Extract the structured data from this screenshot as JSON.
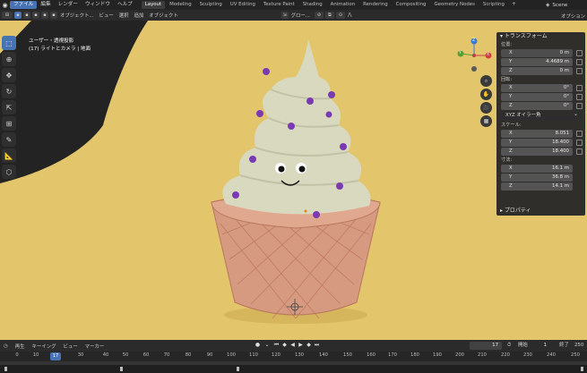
{
  "topbar": {
    "menus": [
      "ファイル",
      "編集",
      "レンダー",
      "ウィンドウ",
      "ヘルプ"
    ],
    "workspaces": [
      "Layout",
      "Modeling",
      "Sculpting",
      "UV Editing",
      "Texture Paint",
      "Shading",
      "Animation",
      "Rendering",
      "Compositing",
      "Geometry Nodes",
      "Scripting"
    ],
    "plus": "+",
    "scene": "Scene"
  },
  "vp_header": {
    "mode": "オブジェクト...",
    "view": "ビュー",
    "select": "選択",
    "add": "追加",
    "object": "オブジェクト",
    "transform_orientation": "グロー...",
    "options": "オプション"
  },
  "viewport": {
    "view_name": "ユーザー・透視投影",
    "collection": "(17) ライトとカメラ | 地面",
    "colors": {
      "background": "#e3c56b",
      "floor": "#222222",
      "cream": "#d9d9c0",
      "cone": "#d7977c",
      "sprinkle": "#7a3bb2"
    }
  },
  "npanel": {
    "transform_title": "トランスフォーム",
    "location_label": "位置:",
    "location": [
      {
        "axis": "X",
        "value": "0 m"
      },
      {
        "axis": "Y",
        "value": "4.4689 m"
      },
      {
        "axis": "Z",
        "value": "0 m"
      }
    ],
    "rotation_label": "回転:",
    "rotation": [
      {
        "axis": "X",
        "value": "0°"
      },
      {
        "axis": "Y",
        "value": "0°"
      },
      {
        "axis": "Z",
        "value": "0°"
      }
    ],
    "rotation_mode": "XYZ オイラー角",
    "scale_label": "スケール:",
    "scale": [
      {
        "axis": "X",
        "value": "8.051"
      },
      {
        "axis": "Y",
        "value": "18.400"
      },
      {
        "axis": "Z",
        "value": "18.400"
      }
    ],
    "dimensions_label": "寸法:",
    "dimensions": [
      {
        "axis": "X",
        "value": "16.1 m"
      },
      {
        "axis": "Y",
        "value": "36.8 m"
      },
      {
        "axis": "Z",
        "value": "14.1 m"
      }
    ],
    "properties_title": "プロパティ"
  },
  "timeline": {
    "playback": "再生",
    "keying": "キーイング",
    "view": "ビュー",
    "marker": "マーカー",
    "current_frame": "17",
    "start_label": "開始",
    "start": "1",
    "end_label": "終了",
    "end": "250",
    "ticks": [
      "0",
      "10",
      "17",
      "30",
      "40",
      "50",
      "60",
      "70",
      "80",
      "90",
      "100",
      "110",
      "120",
      "130",
      "140",
      "150",
      "160",
      "170",
      "180",
      "190",
      "200",
      "210",
      "220",
      "230",
      "240",
      "250"
    ]
  },
  "gizmo": {
    "x_label": "X",
    "y_label": "Y",
    "z_label": "Z"
  }
}
